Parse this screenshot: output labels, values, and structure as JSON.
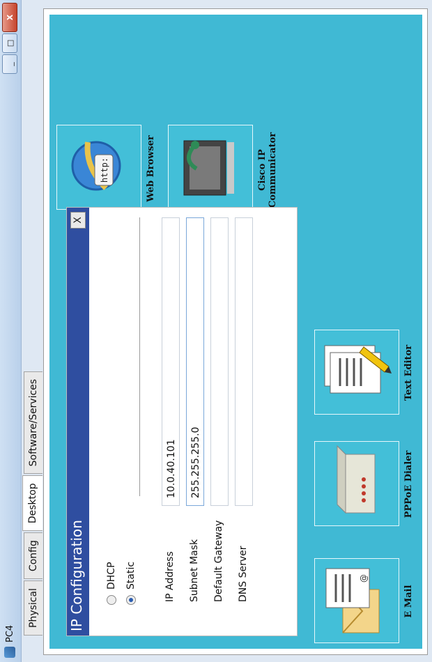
{
  "window": {
    "title": "PC4",
    "minimize": "_",
    "maximize": "□",
    "close": "X"
  },
  "tabs": [
    {
      "label": "Physical"
    },
    {
      "label": "Config"
    },
    {
      "label": "Desktop"
    },
    {
      "label": "Software/Services"
    }
  ],
  "dialog": {
    "title": "IP Configuration",
    "close": "X",
    "dhcp_label": "DHCP",
    "static_label": "Static",
    "selected_mode": "Static",
    "fields": [
      {
        "label": "IP Address",
        "value": "10.0.40.101"
      },
      {
        "label": "Subnet Mask",
        "value": "255.255.255.0"
      },
      {
        "label": "Default Gateway",
        "value": ""
      },
      {
        "label": "DNS Server",
        "value": ""
      }
    ]
  },
  "apps": {
    "web_browser": "Web Browser",
    "cisco_ip_line1": "Cisco IP",
    "cisco_ip_line2": "Communicator",
    "email": "E Mail",
    "pppoe": "PPPoE Dialer",
    "text_editor": "Text Editor",
    "browser_http": "http:"
  },
  "colors": {
    "desktop_bg": "#40b9d4",
    "dialog_header": "#2f4ea0"
  }
}
